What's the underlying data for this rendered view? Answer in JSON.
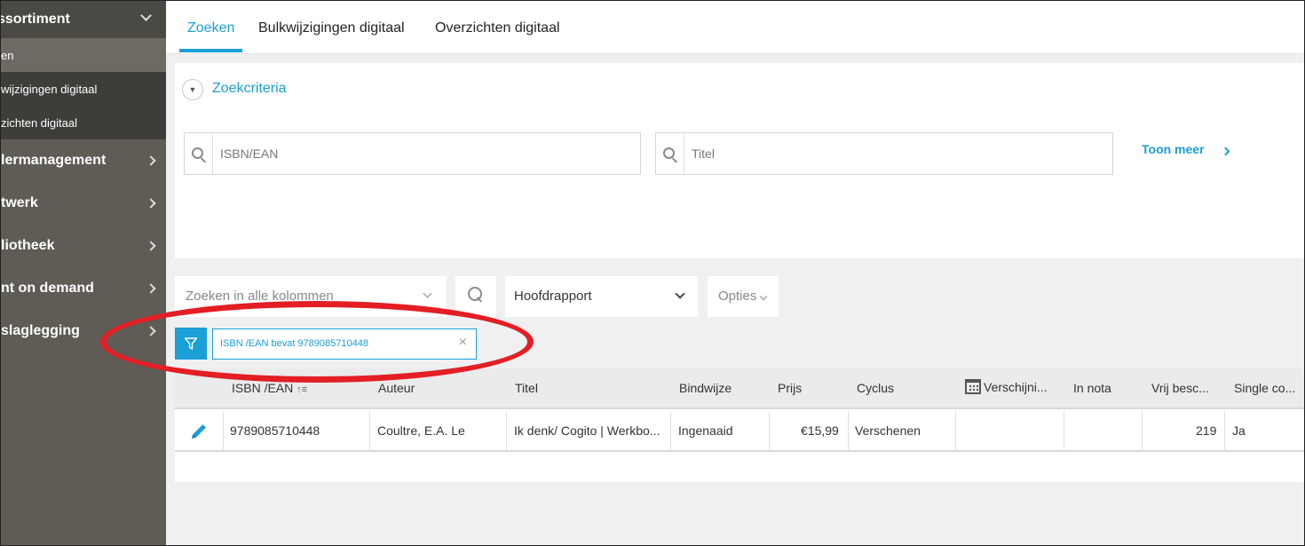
{
  "sidebar": {
    "section_label": "ssortiment",
    "sub_items": [
      {
        "label": "en"
      },
      {
        "label": "wijzigingen digitaal"
      },
      {
        "label": "zichten digitaal"
      }
    ],
    "items": [
      {
        "label": "lermanagement"
      },
      {
        "label": "twerk"
      },
      {
        "label": "liotheek"
      },
      {
        "label": "nt on demand"
      },
      {
        "label": "slaglegging"
      }
    ]
  },
  "tabs": [
    {
      "label": "Zoeken",
      "active": true
    },
    {
      "label": "Bulkwijzigingen digitaal",
      "active": false
    },
    {
      "label": "Overzichten digitaal",
      "active": false
    }
  ],
  "criteria": {
    "title": "Zoekcriteria",
    "isbn_placeholder": "ISBN/EAN",
    "title_placeholder": "Titel",
    "more_label": "Toon meer"
  },
  "toolbar": {
    "column_search_placeholder": "Zoeken in alle kolommen",
    "report_value": "Hoofdrapport",
    "options_label": "Opties"
  },
  "filter": {
    "chip_text": "ISBN /EAN bevat 9789085710448",
    "remove_glyph": "×"
  },
  "table": {
    "headers": [
      "ISBN /EAN",
      "Auteur",
      "Titel",
      "Bindwijze",
      "Prijs",
      "Cyclus",
      "Verschijni...",
      "In nota",
      "Vrij besc...",
      "Single co..."
    ],
    "sort_glyph": "↑≡",
    "rows": [
      [
        "9789085710448",
        "Coultre, E.A. Le",
        "Ik denk/ Cogito | Werkbo...",
        "Ingenaaid",
        "€15,99",
        "Verschenen",
        "",
        "",
        "219",
        "Ja"
      ]
    ]
  },
  "colors": {
    "accent": "#1a9fd6",
    "sidebar": "#5e5c55",
    "annotation": "#e31e24"
  }
}
